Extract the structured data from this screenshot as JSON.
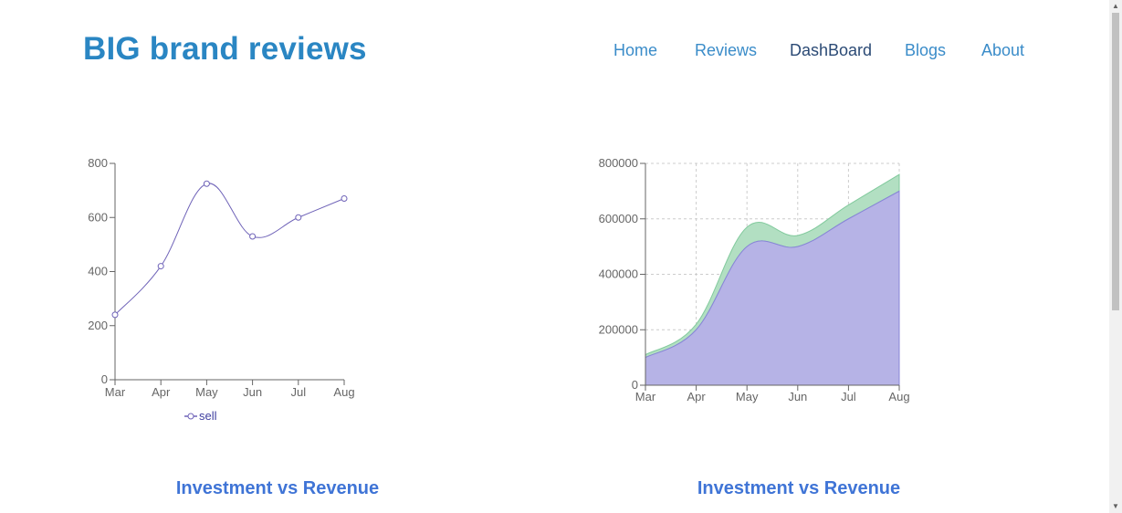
{
  "header": {
    "brand": "BIG brand reviews",
    "nav": [
      {
        "label": "Home",
        "active": false
      },
      {
        "label": "Reviews",
        "active": false
      },
      {
        "label": "DashBoard",
        "active": true
      },
      {
        "label": "Blogs",
        "active": false
      },
      {
        "label": "About",
        "active": false
      }
    ]
  },
  "captions": {
    "left": "Investment vs Revenue",
    "right": "Investment vs Revenue"
  },
  "colors": {
    "brand": "#2a86c3",
    "nav": "#3a8cc9",
    "nav_active": "#2b4a75",
    "line_series": "#6f63b8",
    "area_purple": "#b6b3e6",
    "area_green": "#b2dfc2",
    "caption": "#3f74d6"
  },
  "chart_data": [
    {
      "type": "line",
      "categories": [
        "Mar",
        "Apr",
        "May",
        "Jun",
        "Jul",
        "Aug"
      ],
      "series": [
        {
          "name": "sell",
          "values": [
            240,
            420,
            725,
            530,
            600,
            670
          ]
        }
      ],
      "ylim": [
        0,
        800
      ],
      "yticks": [
        0,
        200,
        400,
        600,
        800
      ],
      "grid": false,
      "legend": "bottom"
    },
    {
      "type": "area",
      "stacked": true,
      "categories": [
        "Mar",
        "Apr",
        "May",
        "Jun",
        "Jul",
        "Aug"
      ],
      "series": [
        {
          "values": [
            100000,
            200000,
            500000,
            500000,
            600000,
            700000
          ]
        },
        {
          "values": [
            10000,
            20000,
            70000,
            40000,
            50000,
            60000
          ]
        }
      ],
      "ylim": [
        0,
        800000
      ],
      "yticks": [
        0,
        200000,
        400000,
        600000,
        800000
      ],
      "grid": true
    }
  ]
}
